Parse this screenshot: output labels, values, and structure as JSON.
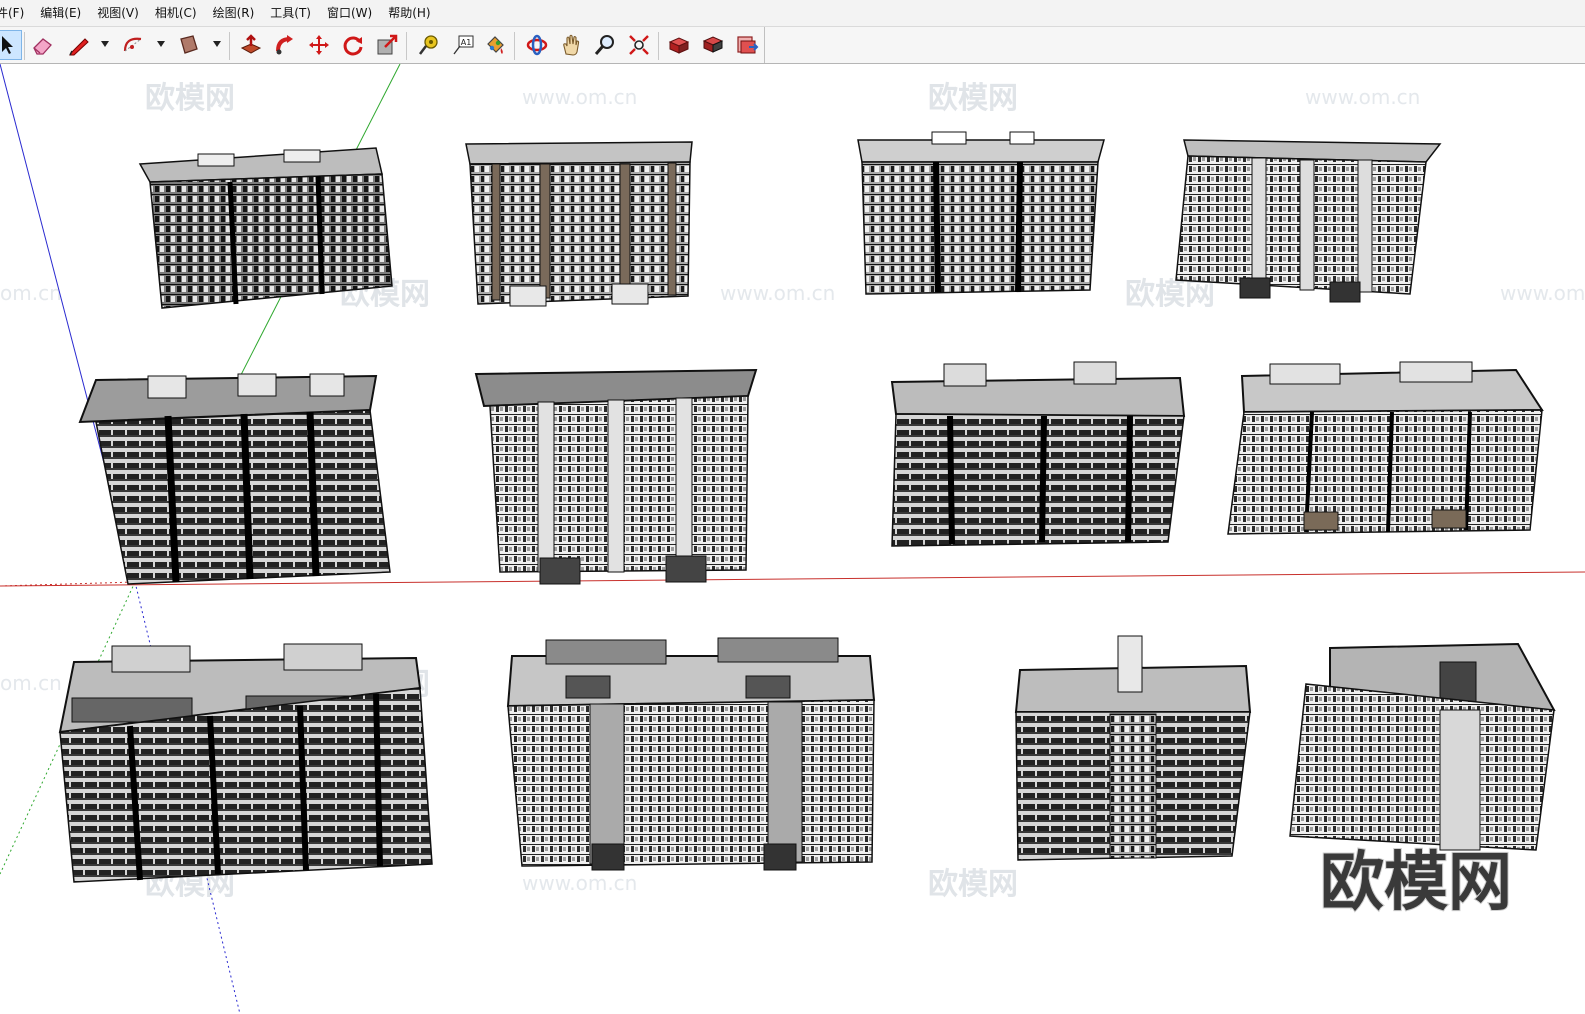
{
  "menu": [
    {
      "label": "件(F)"
    },
    {
      "label": "编辑(E)"
    },
    {
      "label": "视图(V)"
    },
    {
      "label": "相机(C)"
    },
    {
      "label": "绘图(R)"
    },
    {
      "label": "工具(T)"
    },
    {
      "label": "窗口(W)"
    },
    {
      "label": "帮助(H)"
    }
  ],
  "toolbar": {
    "buttons": [
      {
        "icon": "select-arrow-icon",
        "active": true
      },
      {
        "icon": "eraser-icon"
      },
      {
        "icon": "pencil-line-icon"
      },
      {
        "icon": "arc-icon"
      },
      {
        "icon": "rectangle-icon"
      },
      {
        "icon": "push-pull-icon"
      },
      {
        "icon": "follow-me-icon"
      },
      {
        "icon": "move-icon"
      },
      {
        "icon": "rotate-icon"
      },
      {
        "icon": "offset-scale-icon"
      },
      {
        "icon": "tape-measure-icon"
      },
      {
        "icon": "text-label-icon"
      },
      {
        "icon": "paint-bucket-icon"
      },
      {
        "icon": "orbit-icon"
      },
      {
        "icon": "pan-hand-icon"
      },
      {
        "icon": "zoom-icon"
      },
      {
        "icon": "zoom-extents-icon"
      },
      {
        "icon": "3d-warehouse-icon"
      },
      {
        "icon": "component-share-icon"
      },
      {
        "icon": "extension-warehouse-icon"
      }
    ],
    "text_tool_label": "A1"
  },
  "viewport": {
    "watermark_text": "欧模网",
    "watermark_url": "www.om.cn",
    "watermark_partial": "om.cn",
    "brand_text": "欧模网",
    "axis_colors": {
      "red": "#c8302c",
      "green": "#2fa82f",
      "blue": "#2a2ad0"
    },
    "model_count": 12
  }
}
